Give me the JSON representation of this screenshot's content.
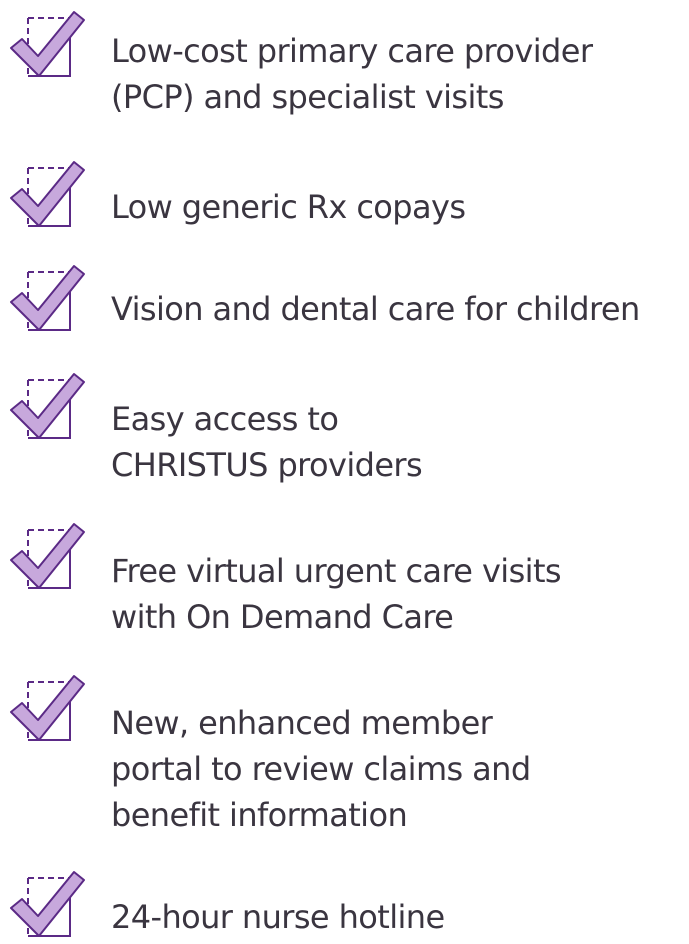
{
  "benefits": [
    {
      "icon": "checkbox-check-icon",
      "lines": [
        "Low-cost primary care provider",
        "(PCP) and specialist visits"
      ]
    },
    {
      "icon": "checkbox-check-icon",
      "lines": [
        "Low generic Rx copays"
      ]
    },
    {
      "icon": "checkbox-check-icon",
      "lines": [
        "Vision and dental care for children"
      ]
    },
    {
      "icon": "checkbox-check-icon",
      "lines": [
        "Easy access to",
        "CHRISTUS providers"
      ]
    },
    {
      "icon": "checkbox-check-icon",
      "lines": [
        "Free virtual urgent care visits",
        "with On Demand Care"
      ]
    },
    {
      "icon": "checkbox-check-icon",
      "lines": [
        "New, enhanced member",
        "portal to review claims and",
        "benefit information"
      ]
    },
    {
      "icon": "checkbox-check-icon",
      "lines": [
        "24-hour nurse hotline"
      ]
    }
  ],
  "colors": {
    "check_fill": "#c7a8dc",
    "check_stroke": "#5b2a86",
    "box_stroke": "#5b2a86",
    "text": "#3a3540"
  }
}
